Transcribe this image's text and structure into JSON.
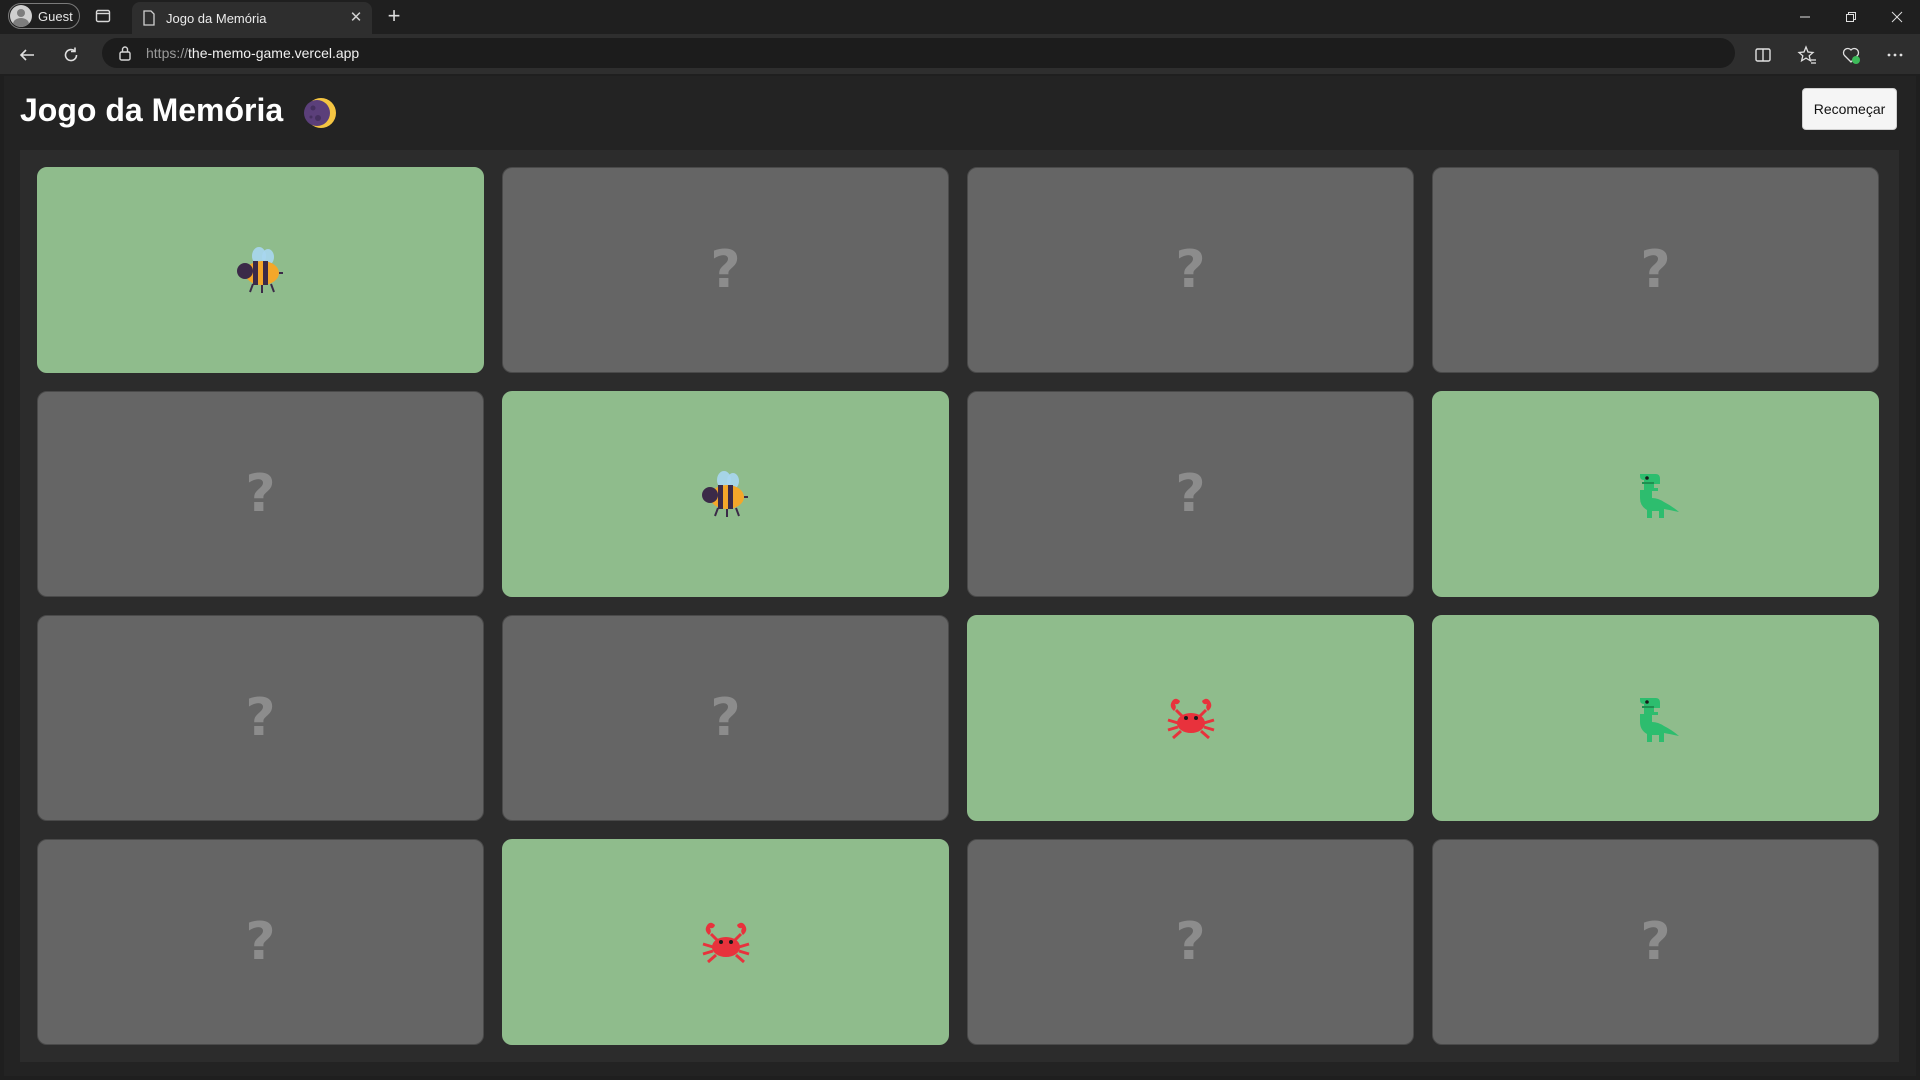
{
  "browser": {
    "profile_label": "Guest",
    "tab_title": "Jogo da Memória",
    "url_protocol": "https://",
    "url_host": "the-memo-game.vercel.app"
  },
  "page": {
    "title": "Jogo da Memória",
    "title_icon": "moon-icon",
    "restart_label": "Recomeçar"
  },
  "cards": [
    {
      "state": "revealed",
      "emoji": "bee"
    },
    {
      "state": "hidden",
      "label": "?"
    },
    {
      "state": "hidden",
      "label": "?"
    },
    {
      "state": "hidden",
      "label": "?"
    },
    {
      "state": "hidden",
      "label": "?"
    },
    {
      "state": "revealed",
      "emoji": "bee"
    },
    {
      "state": "hidden",
      "label": "?"
    },
    {
      "state": "revealed",
      "emoji": "dinosaur"
    },
    {
      "state": "hidden",
      "label": "?"
    },
    {
      "state": "hidden",
      "label": "?"
    },
    {
      "state": "revealed",
      "emoji": "crab"
    },
    {
      "state": "revealed",
      "emoji": "dinosaur"
    },
    {
      "state": "hidden",
      "label": "?"
    },
    {
      "state": "revealed",
      "emoji": "crab"
    },
    {
      "state": "hidden",
      "label": "?"
    },
    {
      "state": "hidden",
      "label": "?"
    }
  ],
  "colors": {
    "card_hidden": "#656565",
    "card_revealed": "#8fbc8c",
    "board_bg": "#2c2c2c",
    "page_bg": "#232323"
  }
}
